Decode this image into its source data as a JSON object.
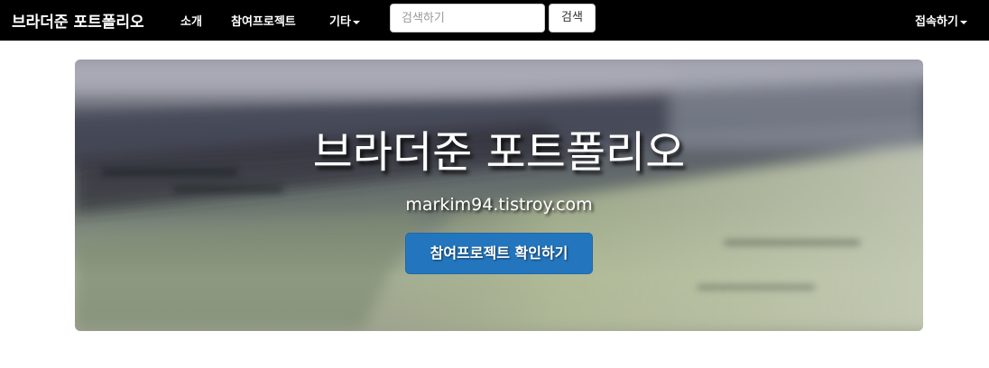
{
  "navbar": {
    "brand": "브라더준 포트폴리오",
    "links": [
      {
        "label": "소개"
      },
      {
        "label": "참여프로젝트"
      },
      {
        "label": "기타"
      }
    ],
    "search": {
      "placeholder": "검색하기",
      "button_label": "검색"
    },
    "account_label": "접속하기"
  },
  "hero": {
    "title": "브라더준 포트폴리오",
    "subtitle": "markim94.tistroy.com",
    "button_label": "참여프로젝트 확인하기"
  },
  "colors": {
    "navbar_bg": "#000000",
    "primary_button": "#2376be"
  }
}
